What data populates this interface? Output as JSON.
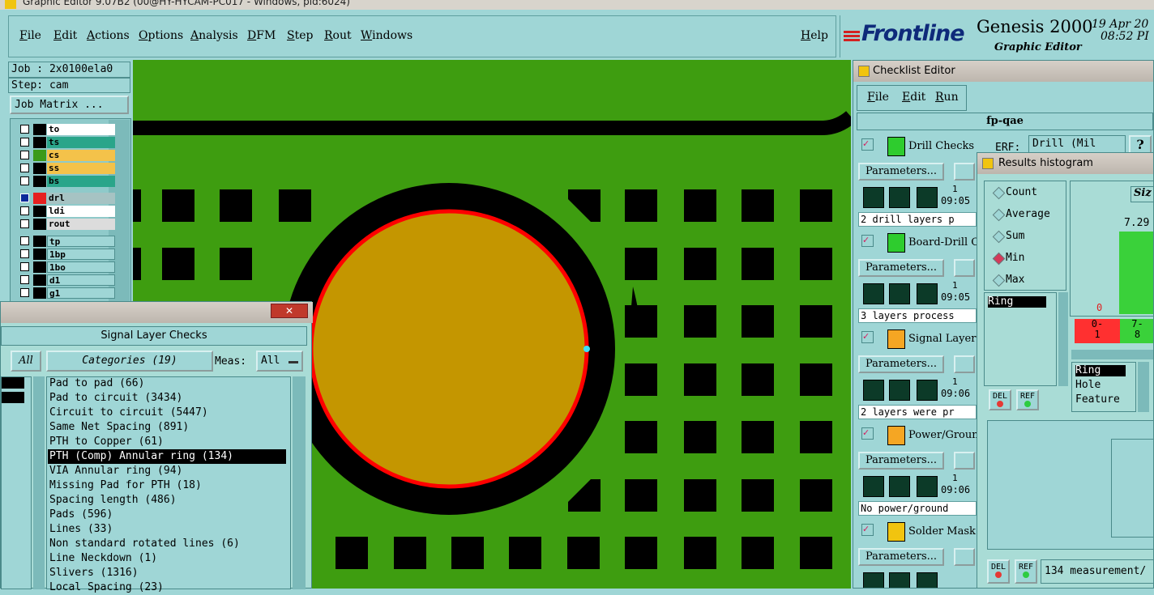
{
  "window_title": "Graphic Editor 9.07B2 (00@HY-HYCAM-PC017 - Windows, pid:6024)",
  "menu": [
    "File",
    "Edit",
    "Actions",
    "Options",
    "Analysis",
    "DFM",
    "Step",
    "Rout",
    "Windows"
  ],
  "help_label": "Help",
  "brand": {
    "logo": "Frontline",
    "product": "Genesis 2000",
    "subtitle": "Graphic Editor",
    "date": "19 Apr 20",
    "time": "08:52 PI"
  },
  "job": {
    "job_label": "Job : 2x0100ela0",
    "step_label": "Step: cam",
    "matrix_button": "Job Matrix ..."
  },
  "layers": [
    {
      "name": "to",
      "color": "#ffffff"
    },
    {
      "name": "ts",
      "color": "#2aa58a"
    },
    {
      "name": "cs",
      "color": "#f4c24a"
    },
    {
      "name": "ss",
      "color": "#f4c24a"
    },
    {
      "name": "bs",
      "color": "#2aa58a"
    },
    {
      "name": "drl",
      "color": "#a6c3c3"
    },
    {
      "name": "ldi",
      "color": "#ffffff"
    },
    {
      "name": "rout",
      "color": "#dcdcdc"
    },
    {
      "name": "tp",
      "color": "#9fd6d6"
    },
    {
      "name": "1bp",
      "color": "#9fd6d6"
    },
    {
      "name": "1bo",
      "color": "#9fd6d6"
    },
    {
      "name": "d1",
      "color": "#9fd6d6"
    },
    {
      "name": "g1",
      "color": "#9fd6d6"
    }
  ],
  "signal_dialog": {
    "title": "Signal Layer Checks",
    "all_label": "All",
    "categories_label": "Categories (19)",
    "meas_label": "Meas:",
    "meas_value": "All",
    "items": [
      "Pad to pad (66)",
      "Pad to circuit (3434)",
      "Circuit to circuit (5447)",
      "Same Net Spacing (891)",
      "PTH to Copper (61)",
      "PTH (Comp) Annular ring (134)",
      "VIA Annular ring (94)",
      "Missing Pad for PTH (18)",
      "Spacing length (486)",
      "Pads (596)",
      "Lines (33)",
      "Non standard rotated lines (6)",
      "Line Neckdown (1)",
      "Slivers (1316)",
      "Local Spacing (23)"
    ],
    "selected_index": 5
  },
  "checklist": {
    "title": "Checklist Editor",
    "menu": [
      "File",
      "Edit",
      "Run"
    ],
    "name": "fp-qae",
    "erf_label": "ERF:",
    "erf_value": "Drill (Mil",
    "help_q": "?",
    "params_label": "Parameters...",
    "checks": [
      {
        "name": "Drill Checks",
        "icon_color": "#2ecc2e",
        "time": "09:05",
        "time_prefix": "1",
        "status": "2 drill layers p"
      },
      {
        "name": "Board-Drill C",
        "icon_color": "#2ecc2e",
        "time": "09:05",
        "time_prefix": "1",
        "status": "3 layers process"
      },
      {
        "name": "Signal Layer",
        "icon_color": "#f5a623",
        "time": "09:06",
        "time_prefix": "1",
        "status": "2 layers were pr"
      },
      {
        "name": "Power/Ground",
        "icon_color": "#f5a623",
        "time": "09:06",
        "time_prefix": "1",
        "status": "No power/ground"
      },
      {
        "name": "Solder Mask",
        "icon_color": "#f1c40f",
        "time": "",
        "time_prefix": "",
        "status": ""
      }
    ]
  },
  "histogram": {
    "title": "Results histogram",
    "options": [
      "Count",
      "Average",
      "Sum",
      "Min",
      "Max"
    ],
    "selected_option": "Min",
    "list_left": [
      "Ring"
    ],
    "size_label": "Siz",
    "bar_value": "7.29",
    "axis_zero": "0",
    "bins": [
      {
        "label": "0-\n1",
        "color": "#ff3030"
      },
      {
        "label": "7-\n8",
        "color": "#3ad13a"
      }
    ],
    "list_right": [
      "Ring",
      "Hole",
      "Feature"
    ],
    "del_label": "DEL",
    "ref_label": "REF",
    "measurement_text": "134 measurement/"
  }
}
